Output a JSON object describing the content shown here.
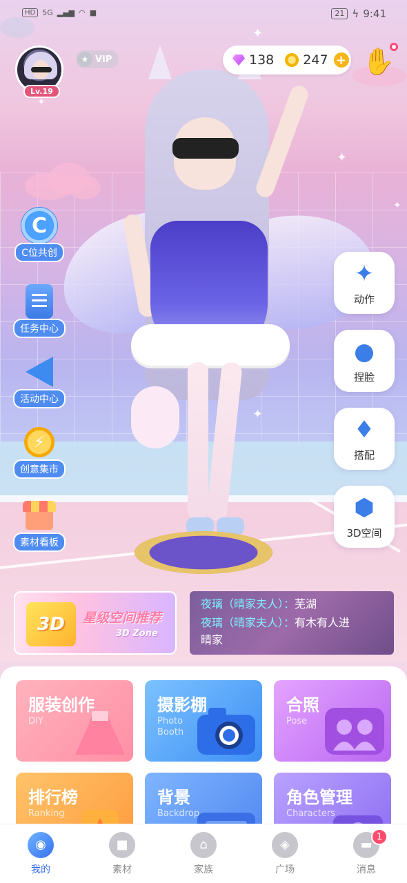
{
  "status_bar": {
    "hd": "HD",
    "signal": "5G",
    "battery": "21",
    "time": "9:41"
  },
  "profile": {
    "level": "Lv.19",
    "vip": "VIP"
  },
  "currency": {
    "gems": "138",
    "coins": "247"
  },
  "left_menu": [
    {
      "label": "C位共创",
      "icon": "c-position-icon",
      "icon_text": "C"
    },
    {
      "label": "任务中心",
      "icon": "task-board-icon"
    },
    {
      "label": "活动中心",
      "icon": "megaphone-icon"
    },
    {
      "label": "创意集市",
      "icon": "lightbulb-icon",
      "icon_text": "⚡"
    },
    {
      "label": "素材看板",
      "icon": "shop-icon"
    }
  ],
  "right_menu": [
    {
      "label": "动作",
      "icon": "action-icon",
      "glyph": "✦"
    },
    {
      "label": "捏脸",
      "icon": "face-edit-icon",
      "glyph": "●"
    },
    {
      "label": "搭配",
      "icon": "dress-icon",
      "glyph": "♦"
    },
    {
      "label": "3D空间",
      "icon": "cube-icon",
      "glyph": "⬢"
    }
  ],
  "promo": {
    "cube": "3D",
    "title": "星级空间推荐",
    "subtitle": "3D Zone"
  },
  "news": [
    {
      "name": "夜璃（晴家夫人）：",
      "text": "芜湖"
    },
    {
      "name": "夜璃（晴家夫人）：",
      "text": "有木有人进"
    },
    {
      "name": "",
      "text": "晴家"
    }
  ],
  "features": [
    {
      "title": "服装创作",
      "sub": "DIY"
    },
    {
      "title": "摄影棚",
      "sub": "Photo Booth"
    },
    {
      "title": "合照",
      "sub": "Pose"
    },
    {
      "title": "排行榜",
      "sub": "Ranking"
    },
    {
      "title": "背景",
      "sub": "Backdrop"
    },
    {
      "title": "角色管理",
      "sub": "Characters"
    }
  ],
  "bottom_nav": [
    {
      "label": "我的",
      "active": true
    },
    {
      "label": "素材"
    },
    {
      "label": "家族"
    },
    {
      "label": "广场"
    },
    {
      "label": "消息",
      "badge": "1"
    }
  ],
  "colors": {
    "accent": "#3a6ff0",
    "label_blue": "#4f8cf2",
    "badge_red": "#ff4d6d"
  }
}
